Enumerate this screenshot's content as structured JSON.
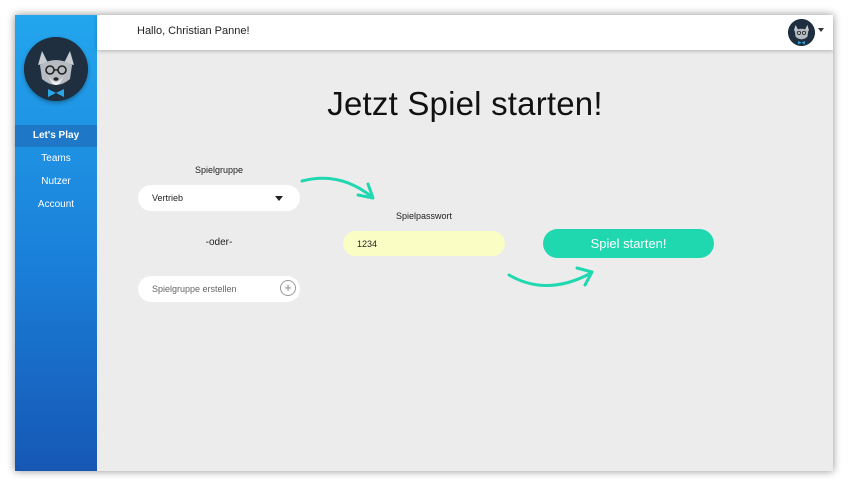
{
  "header": {
    "greeting": "Hallo, Christian Panne!"
  },
  "sidebar": {
    "items": [
      {
        "label": "Let's Play",
        "active": true
      },
      {
        "label": "Teams",
        "active": false
      },
      {
        "label": "Nutzer",
        "active": false
      },
      {
        "label": "Account",
        "active": false
      }
    ]
  },
  "main": {
    "title": "Jetzt Spiel starten!",
    "group_label": "Spielgruppe",
    "group_select_value": "Vertrieb",
    "or_label": "-oder-",
    "create_group_placeholder": "Spielgruppe erstellen",
    "password_label": "Spielpasswort",
    "password_value": "1234",
    "start_button_label": "Spiel starten!"
  },
  "colors": {
    "accent": "#1fd8b0",
    "sidebar_top": "#23a6ee",
    "sidebar_bottom": "#1657b4",
    "password_bg": "#fafec5"
  },
  "icons": [
    "wolf-logo-icon",
    "avatar-icon",
    "dropdown-caret-icon",
    "plus-circle-icon",
    "arrow-icon"
  ]
}
